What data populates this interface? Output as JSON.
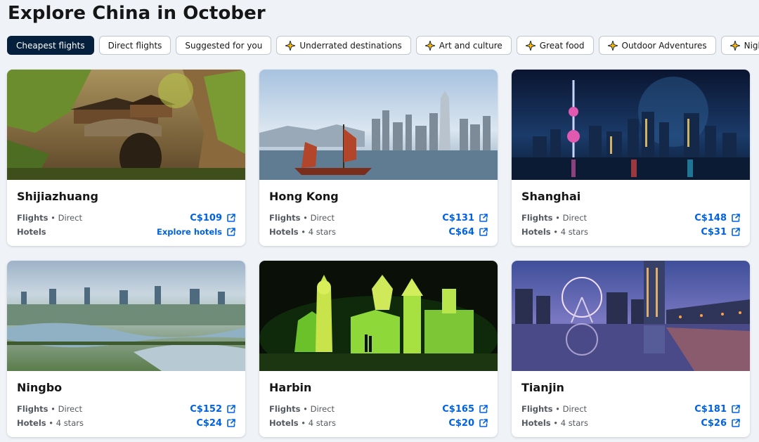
{
  "page": {
    "title": "Explore China in October"
  },
  "filters": [
    {
      "label": "Cheapest flights",
      "active": true,
      "icon": ""
    },
    {
      "label": "Direct flights",
      "active": false,
      "icon": ""
    },
    {
      "label": "Suggested for you",
      "active": false,
      "icon": ""
    },
    {
      "label": "Underrated destinations",
      "active": false,
      "icon": "sparkle-icon"
    },
    {
      "label": "Art and culture",
      "active": false,
      "icon": "sparkle-icon"
    },
    {
      "label": "Great food",
      "active": false,
      "icon": "sparkle-icon"
    },
    {
      "label": "Outdoor Adventures",
      "active": false,
      "icon": "sparkle-icon"
    },
    {
      "label": "Nightlife and e",
      "active": false,
      "icon": "sparkle-icon"
    }
  ],
  "cards": [
    {
      "city": "Shijiazhuang",
      "flights_label": "Flights",
      "flights_detail": "Direct",
      "flights_price": "C$109",
      "hotels_label": "Hotels",
      "hotels_detail": "",
      "hotels_price": "Explore hotels"
    },
    {
      "city": "Hong Kong",
      "flights_label": "Flights",
      "flights_detail": "Direct",
      "flights_price": "C$131",
      "hotels_label": "Hotels",
      "hotels_detail": "4 stars",
      "hotels_price": "C$64"
    },
    {
      "city": "Shanghai",
      "flights_label": "Flights",
      "flights_detail": "Direct",
      "flights_price": "C$148",
      "hotels_label": "Hotels",
      "hotels_detail": "4 stars",
      "hotels_price": "C$31"
    },
    {
      "city": "Ningbo",
      "flights_label": "Flights",
      "flights_detail": "Direct",
      "flights_price": "C$152",
      "hotels_label": "Hotels",
      "hotels_detail": "4 stars",
      "hotels_price": "C$24"
    },
    {
      "city": "Harbin",
      "flights_label": "Flights",
      "flights_detail": "Direct",
      "flights_price": "C$165",
      "hotels_label": "Hotels",
      "hotels_detail": "4 stars",
      "hotels_price": "C$20"
    },
    {
      "city": "Tianjin",
      "flights_label": "Flights",
      "flights_detail": "Direct",
      "flights_price": "C$181",
      "hotels_label": "Hotels",
      "hotels_detail": "4 stars",
      "hotels_price": "C$26"
    }
  ],
  "colors": {
    "accent": "#0062e3",
    "active_chip": "#05203c",
    "background": "#eff3f8"
  }
}
